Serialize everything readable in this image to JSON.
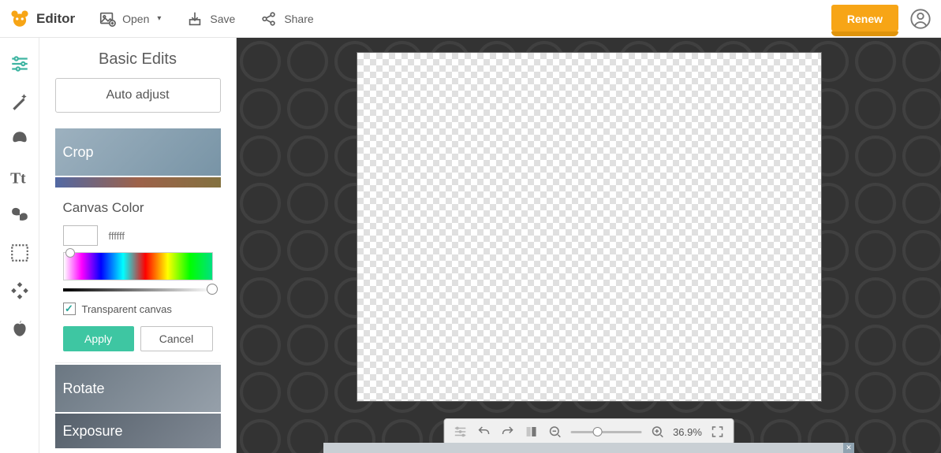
{
  "brand": {
    "name": "Editor"
  },
  "topbar": {
    "open": "Open",
    "save": "Save",
    "share": "Share",
    "renew": "Renew"
  },
  "panel": {
    "title": "Basic Edits",
    "auto_adjust": "Auto adjust",
    "crop": "Crop",
    "canvas_color": {
      "title": "Canvas Color",
      "hex": "ffffff",
      "transparent_label": "Transparent canvas",
      "transparent_checked": true,
      "apply": "Apply",
      "cancel": "Cancel"
    },
    "rotate": "Rotate",
    "exposure": "Exposure"
  },
  "canvas_toolbar": {
    "zoom_text": "36.9%"
  },
  "colors": {
    "accent_orange": "#f7a516",
    "accent_teal": "#3ec6a2"
  }
}
